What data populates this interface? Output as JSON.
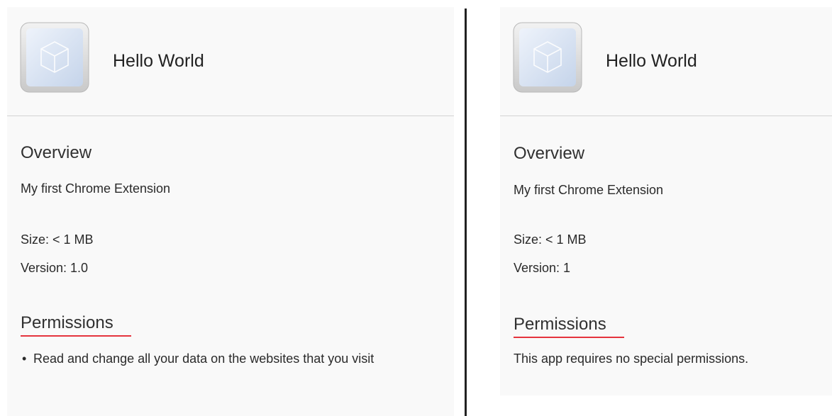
{
  "left_panel": {
    "app_name": "Hello World",
    "icon": "cube-icon",
    "overview_heading": "Overview",
    "description": "My first Chrome Extension",
    "size": "Size: < 1 MB",
    "version": "Version: 1.0",
    "permissions_heading": "Permissions",
    "permissions": [
      "Read and change all your data on the websites that you visit"
    ]
  },
  "right_panel": {
    "app_name": "Hello World",
    "icon": "cube-icon",
    "overview_heading": "Overview",
    "description": "My first Chrome Extension",
    "size": "Size: < 1 MB",
    "version": "Version: 1",
    "permissions_heading": "Permissions",
    "permissions_note": "This app requires no special permissions."
  },
  "colors": {
    "accent_underline": "#e5343d",
    "panel_background": "#f9f9f9",
    "divider": "#222222"
  }
}
